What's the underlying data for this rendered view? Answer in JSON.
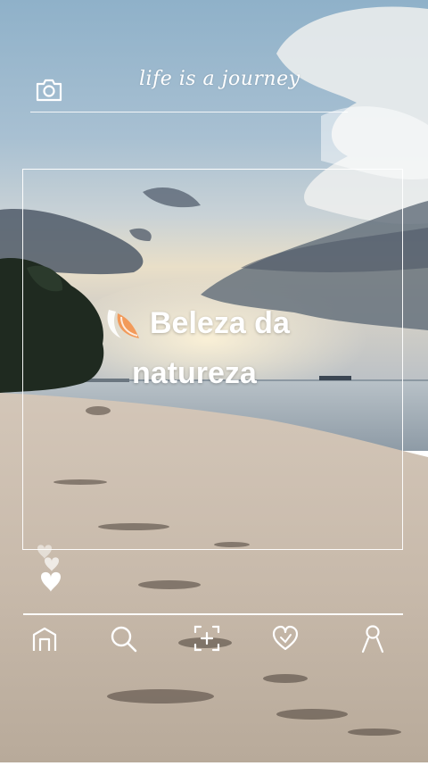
{
  "header": {
    "handwritten_title": "life is a journey",
    "camera_icon": "camera-icon"
  },
  "caption": {
    "line1": "Beleza da",
    "line2": "natureza"
  },
  "hearts_icon": "hearts-like-icon",
  "nav": [
    {
      "icon": "home-icon"
    },
    {
      "icon": "search-icon"
    },
    {
      "icon": "add-post-icon"
    },
    {
      "icon": "heart-icon"
    },
    {
      "icon": "profile-icon"
    }
  ],
  "colors": {
    "sky_top": "#8fb0c8",
    "sand": "#c9bcae",
    "sea": "#9fb0bd",
    "overlay_lines": "#ffffff"
  }
}
